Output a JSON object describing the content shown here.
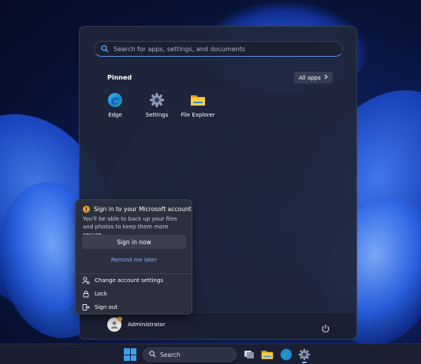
{
  "start_menu": {
    "search_placeholder": "Search for apps, settings, and documents",
    "pinned_title": "Pinned",
    "all_apps_label": "All apps",
    "pinned": [
      {
        "label": "Edge",
        "icon": "edge-icon"
      },
      {
        "label": "Settings",
        "icon": "gear-icon"
      },
      {
        "label": "File Explorer",
        "icon": "folder-icon"
      }
    ],
    "user_name": "Administrator"
  },
  "account_flyout": {
    "title": "Sign in to your Microsoft account",
    "description": "You'll be able to back up your files and photos to keep them more secure.",
    "sign_in_label": "Sign in now",
    "remind_label": "Remind me later",
    "items": [
      {
        "label": "Change account settings",
        "icon": "account-settings-icon"
      },
      {
        "label": "Lock",
        "icon": "lock-icon"
      },
      {
        "label": "Sign out",
        "icon": "sign-out-icon"
      }
    ]
  },
  "taskbar": {
    "search_label": "Search"
  },
  "colors": {
    "accent": "#3aa0f0",
    "link": "#7fb3ff",
    "warning": "#f39c2a"
  }
}
